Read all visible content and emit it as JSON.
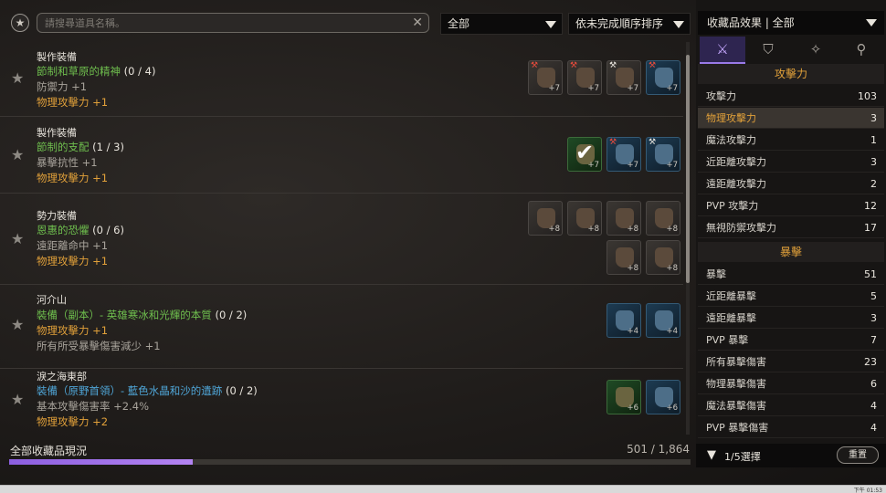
{
  "search": {
    "placeholder": "請搜尋道具名稱。"
  },
  "filters": {
    "category": "全部",
    "sort": "依未完成順序排序"
  },
  "collections": [
    {
      "category": "製作裝備",
      "name": "節制和草原的精神",
      "progress": "(0 / 4)",
      "lines": [
        "防禦力 +1",
        "物理攻擊力 +1"
      ]
    },
    {
      "category": "製作裝備",
      "name": "節制的支配",
      "progress": "(1 / 3)",
      "lines": [
        "暴擊抗性 +1",
        "物理攻擊力 +1"
      ]
    },
    {
      "category": "勢力裝備",
      "name": "恩惠的恐懼",
      "progress": "(0 / 6)",
      "lines": [
        "遠距離命中 +1",
        "物理攻擊力 +1"
      ]
    },
    {
      "category": "河介山",
      "name": "裝備（副本）- 英雄寒冰和光輝的本質",
      "progress": "(0 / 2)",
      "lines": [
        "物理攻擊力 +1",
        "所有所受暴擊傷害減少 +1"
      ]
    },
    {
      "category": "淚之海東部",
      "name": "裝備（原野首領）- 藍色水晶和沙的遺跡",
      "progress": "(0 / 2)",
      "lines": [
        "基本攻擊傷害率 +2.4%",
        "物理攻擊力 +2"
      ]
    }
  ],
  "item_counts": {
    "row0": [
      "+7",
      "+7",
      "+7",
      "+7"
    ],
    "row1": [
      "+7",
      "+7",
      "+7"
    ],
    "row2": [
      "+8",
      "+8",
      "+8",
      "+8",
      "+8",
      "+8"
    ],
    "row3": [
      "+4",
      "+4"
    ],
    "row4": [
      "+6",
      "+6"
    ]
  },
  "progress": {
    "label": "全部收藏品現況",
    "count": "501 / 1,864",
    "fraction": 0.2688
  },
  "panel": {
    "header": "收藏品效果 | 全部",
    "sections": [
      {
        "title": "攻擊力",
        "rows": [
          {
            "k": "攻擊力",
            "v": "103"
          },
          {
            "k": "物理攻擊力",
            "v": "3"
          },
          {
            "k": "魔法攻擊力",
            "v": "1"
          },
          {
            "k": "近距離攻擊力",
            "v": "3"
          },
          {
            "k": "遠距離攻擊力",
            "v": "2"
          },
          {
            "k": "PVP 攻擊力",
            "v": "12"
          },
          {
            "k": "無視防禦攻擊力",
            "v": "17"
          }
        ]
      },
      {
        "title": "暴擊",
        "rows": [
          {
            "k": "暴擊",
            "v": "51"
          },
          {
            "k": "近距離暴擊",
            "v": "5"
          },
          {
            "k": "遠距離暴擊",
            "v": "3"
          },
          {
            "k": "PVP 暴擊",
            "v": "7"
          },
          {
            "k": "所有暴擊傷害",
            "v": "23"
          },
          {
            "k": "物理暴擊傷害",
            "v": "6"
          },
          {
            "k": "魔法暴擊傷害",
            "v": "4"
          },
          {
            "k": "PVP 暴擊傷害",
            "v": "4"
          }
        ]
      }
    ],
    "footer": {
      "selection": "1/5選擇",
      "reset": "重置"
    }
  },
  "taskbar": {
    "clock": "下午 01:53"
  },
  "colors": {
    "accent": "#9a7ae8",
    "green": "#6fbf4e",
    "blue": "#4fa6d8",
    "orange": "#e2a13a"
  }
}
